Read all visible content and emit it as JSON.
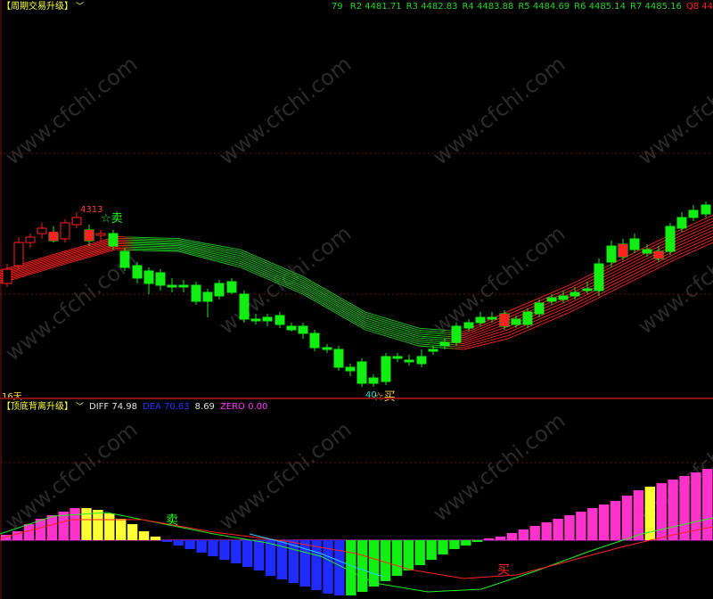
{
  "main": {
    "title": "【周期交易升级】",
    "period_label": "16天",
    "levels": [
      {
        "name": "R2",
        "value": "4481.71",
        "color": "#25d425"
      },
      {
        "name": "R3",
        "value": "4482.83",
        "color": "#25d425"
      },
      {
        "name": "R4",
        "value": "4483.88",
        "color": "#25d425"
      },
      {
        "name": "R5",
        "value": "4484.69",
        "color": "#25d425"
      },
      {
        "name": "R6",
        "value": "4485.14",
        "color": "#25d425"
      },
      {
        "name": "R7",
        "value": "4485.16",
        "color": "#25d425"
      },
      {
        "name": "Q8",
        "value": "44",
        "color": "#ff2020"
      }
    ],
    "levels_prefix": "79",
    "high_label": "4313",
    "low_label": "40",
    "sell_signal": "☆卖",
    "buy_signal": "☆买",
    "watermark": "www.cfchi.com"
  },
  "sub": {
    "title": "【顶底背离升级】",
    "indicators": [
      {
        "name": "DIFF",
        "value": "74.98",
        "color": "#e0e0e0"
      },
      {
        "name": "DEA",
        "value": "70.63",
        "color": "#2233ff"
      },
      {
        "name": "",
        "value": "8.69",
        "color": "#e0e0e0"
      },
      {
        "name": "ZERO",
        "value": "0.00",
        "color": "#ff33ff"
      }
    ],
    "sell_signal": "卖",
    "buy_signal": "买"
  },
  "colors": {
    "up": "#ff2020",
    "down": "#11ee11",
    "yellow": "#ffff33",
    "magenta": "#ff33cc",
    "blue": "#1f2bff",
    "green": "#11ee11"
  }
}
